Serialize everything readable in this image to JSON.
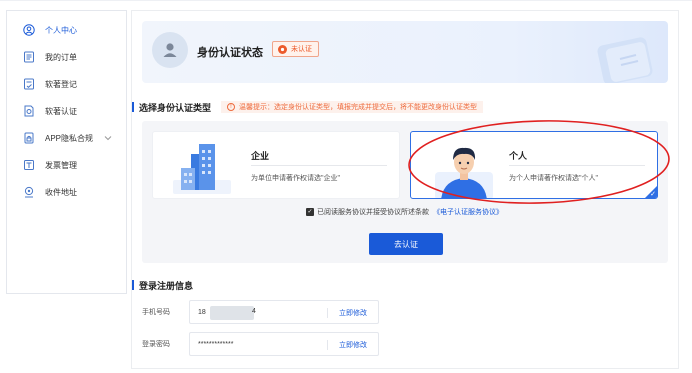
{
  "sidebar": {
    "items": [
      {
        "label": "个人中心",
        "icon": "user-circle-icon",
        "active": true
      },
      {
        "label": "我的订单",
        "icon": "order-list-icon"
      },
      {
        "label": "软著登记",
        "icon": "register-doc-icon"
      },
      {
        "label": "软著认证",
        "icon": "certify-doc-icon"
      },
      {
        "label": "APP隐私合规",
        "icon": "privacy-compliance-icon",
        "has_submenu": true
      },
      {
        "label": "发票管理",
        "icon": "invoice-icon"
      },
      {
        "label": "收件地址",
        "icon": "location-pin-icon"
      }
    ]
  },
  "status": {
    "title": "身份认证状态",
    "badge": "未认证"
  },
  "select_type": {
    "title": "选择身份认证类型",
    "tip": "温馨提示：选定身份认证类型，填报完成并提交后，将不能更改身份认证类型"
  },
  "types": [
    {
      "title": "企业",
      "desc": "为单位申请著作权请选\"企业\"",
      "selected": false
    },
    {
      "title": "个人",
      "desc": "为个人申请著作权请选\"个人\"",
      "selected": true
    }
  ],
  "agree": {
    "text": "已阅读服务协议并接受协议所述条款",
    "link": "《电子认证服务协议》",
    "checked": true
  },
  "submit_label": "去认证",
  "login_info": {
    "title": "登录注册信息",
    "phone_label": "手机号码",
    "phone_value_start": "18",
    "phone_value_end": "4",
    "password_label": "登录密码",
    "password_value": "*************",
    "edit_label": "立即修改"
  },
  "colors": {
    "accent": "#1a5ad8",
    "warning": "#ec5a2b",
    "annotation": "#e02020"
  }
}
